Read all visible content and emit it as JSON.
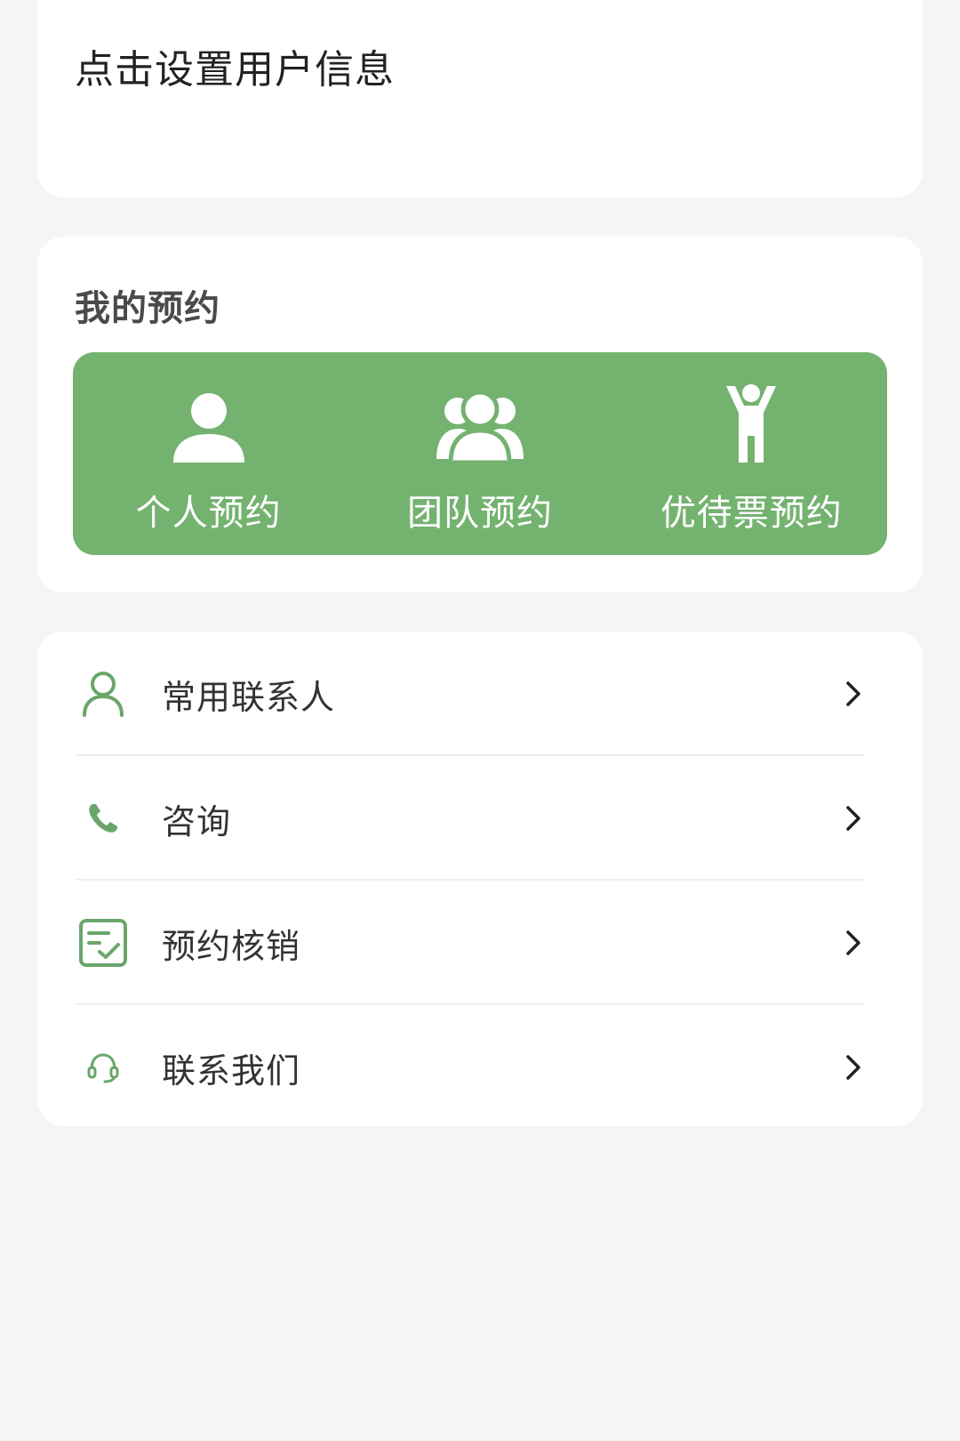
{
  "colors": {
    "background": "#f5f5f5",
    "card": "#ffffff",
    "accent_green": "#74b270",
    "icon_green": "#6aa66b",
    "text_dark": "#333333"
  },
  "profile": {
    "prompt": "点击设置用户信息"
  },
  "booking": {
    "title": "我的预约",
    "options": [
      {
        "label": "个人预约",
        "icon": "person-icon"
      },
      {
        "label": "团队预约",
        "icon": "group-icon"
      },
      {
        "label": "优待票预约",
        "icon": "child-icon"
      }
    ]
  },
  "menu": {
    "items": [
      {
        "label": "常用联系人",
        "icon": "contact-icon"
      },
      {
        "label": "咨询",
        "icon": "phone-icon"
      },
      {
        "label": "预约核销",
        "icon": "checklist-icon"
      },
      {
        "label": "联系我们",
        "icon": "headset-icon"
      }
    ]
  }
}
